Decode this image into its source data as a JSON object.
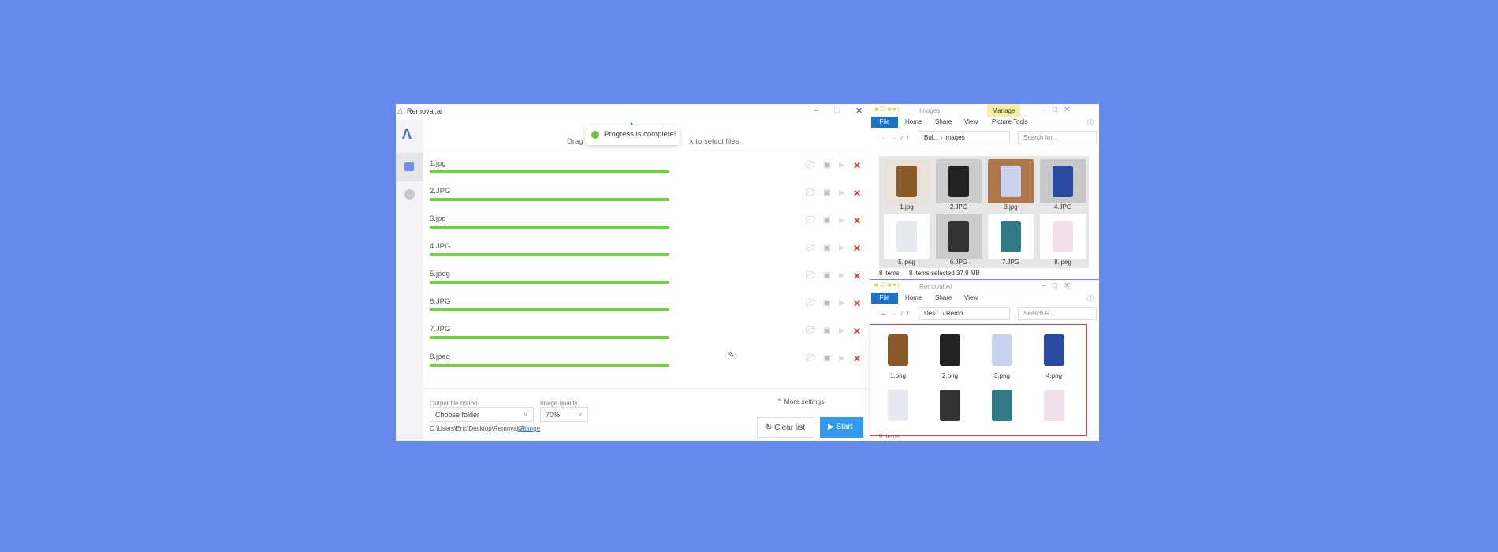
{
  "app": {
    "title": "Removal.ai",
    "toast": "Progress is complete!",
    "drop_hint_left": "Drag",
    "drop_hint_right": "k to select files",
    "files": [
      {
        "name": "1.jpg",
        "progress": 100
      },
      {
        "name": "2.JPG",
        "progress": 100
      },
      {
        "name": "3.jpg",
        "progress": 100
      },
      {
        "name": "4.JPG",
        "progress": 100
      },
      {
        "name": "5.jpeg",
        "progress": 100
      },
      {
        "name": "6.JPG",
        "progress": 100
      },
      {
        "name": "7.JPG",
        "progress": 100
      },
      {
        "name": "8.jpeg",
        "progress": 100
      }
    ],
    "output_label": "Output file option",
    "output_value": "Choose folder",
    "quality_label": "Image quality",
    "quality_value": "70%",
    "more_settings": "More settings",
    "path": "C:\\Users\\Eric\\Desktop\\Removal.AI",
    "change": "Change",
    "clear": "Clear list",
    "start": "Start",
    "progress_color": "#6fd33e",
    "accent": "#3399f0"
  },
  "explorer1": {
    "title": "Images",
    "manage": "Manage",
    "tabs": [
      "File",
      "Home",
      "Share",
      "View",
      "Picture Tools"
    ],
    "crumb1": "Bul...",
    "crumb2": "Images",
    "search": "Search Im...",
    "items": [
      "1.jpg",
      "2.JPG",
      "3.jpg",
      "4.JPG",
      "5.jpeg",
      "6.JPG",
      "7.JPG",
      "8.jpeg"
    ],
    "status_count": "8 items",
    "status_sel": "8 items selected  37.9 MB"
  },
  "explorer2": {
    "title": "Removal.AI",
    "tabs": [
      "File",
      "Home",
      "Share",
      "View"
    ],
    "crumb1": "Des...",
    "crumb2": "Remo...",
    "search": "Search R...",
    "items": [
      "1.png",
      "2.png",
      "3.png",
      "4.png"
    ],
    "status_count": "8 items"
  }
}
